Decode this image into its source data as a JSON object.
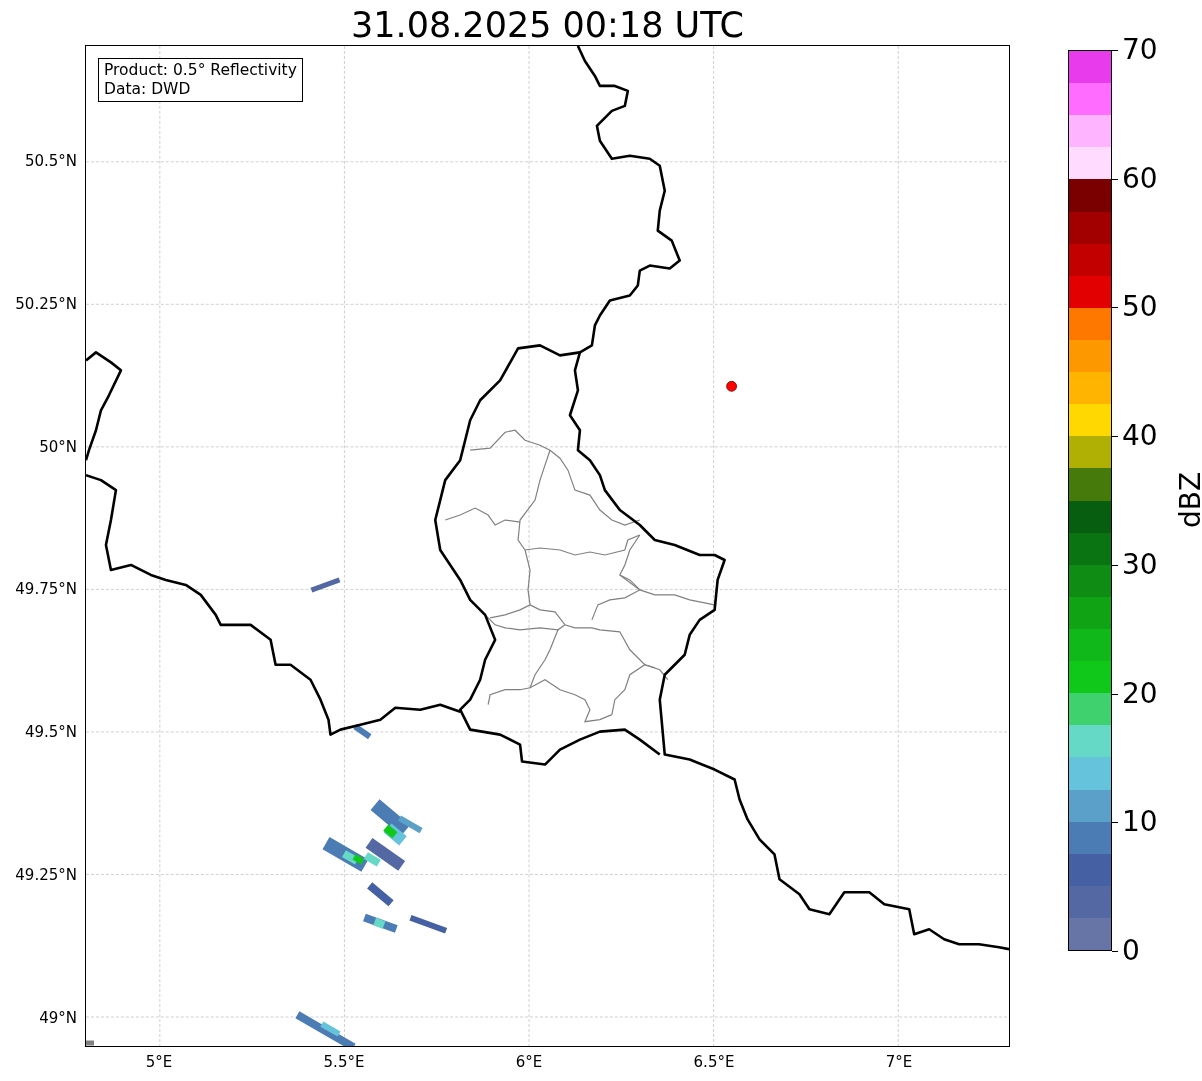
{
  "title": "31.08.2025 00:18 UTC",
  "legend": [
    "Product: 0.5° Reflectivity",
    "Data: DWD"
  ],
  "lat_ticks": [
    "50.5°N",
    "50.25°N",
    "50°N",
    "49.75°N",
    "49.5°N",
    "49.25°N",
    "49°N"
  ],
  "lon_ticks": [
    "5°E",
    "5.5°E",
    "6°E",
    "6.5°E",
    "7°E"
  ],
  "colorbar": {
    "label": "dBZ",
    "ticks": [
      "70",
      "60",
      "50",
      "40",
      "30",
      "20",
      "10",
      "0"
    ],
    "segments": [
      {
        "color": "#e83cec"
      },
      {
        "color": "#ff6cff"
      },
      {
        "color": "#ffb4ff"
      },
      {
        "color": "#ffdcff"
      },
      {
        "color": "#7a0000"
      },
      {
        "color": "#a20000"
      },
      {
        "color": "#c20000"
      },
      {
        "color": "#e20000"
      },
      {
        "color": "#fe7800"
      },
      {
        "color": "#fe9800"
      },
      {
        "color": "#feb400"
      },
      {
        "color": "#fed800"
      },
      {
        "color": "#b0b004"
      },
      {
        "color": "#467a0a"
      },
      {
        "color": "#075e10"
      },
      {
        "color": "#0a7412"
      },
      {
        "color": "#0e8c14"
      },
      {
        "color": "#10a414"
      },
      {
        "color": "#10b81a"
      },
      {
        "color": "#10c81a"
      },
      {
        "color": "#3ed16e"
      },
      {
        "color": "#66d8c6"
      },
      {
        "color": "#66c3dc"
      },
      {
        "color": "#5aa0c8"
      },
      {
        "color": "#4c7cb4"
      },
      {
        "color": "#4560a3"
      },
      {
        "color": "#5468a3"
      },
      {
        "color": "#6674a6"
      }
    ]
  }
}
